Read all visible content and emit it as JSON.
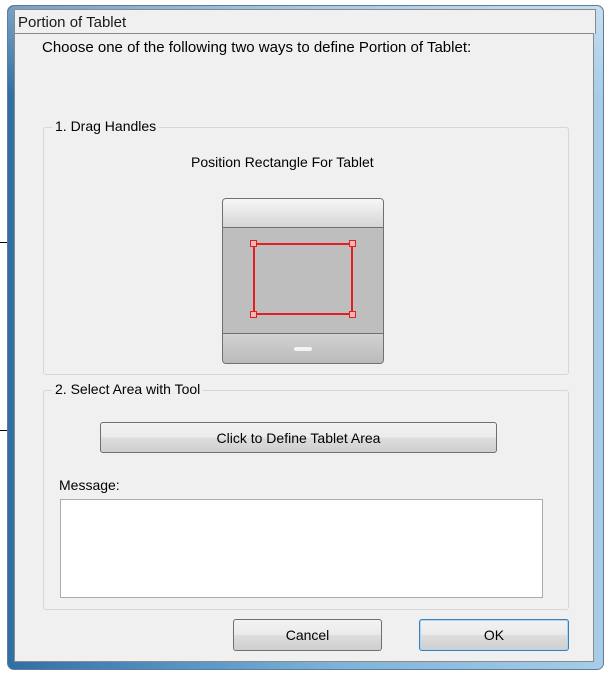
{
  "window": {
    "title": "Portion of Tablet",
    "instruction": "Choose one of the following two ways to define Portion of Tablet:"
  },
  "drag_handles": {
    "group_label": "1. Drag Handles",
    "subtitle": "Position Rectangle For Tablet"
  },
  "select_area": {
    "group_label": "2. Select Area with Tool",
    "define_button": "Click to Define Tablet Area",
    "message_label": "Message:",
    "message_text": ""
  },
  "buttons": {
    "cancel": "Cancel",
    "ok": "OK"
  },
  "colors": {
    "selection_rect": "#e02020",
    "window_frame": "#4f8fc0"
  }
}
